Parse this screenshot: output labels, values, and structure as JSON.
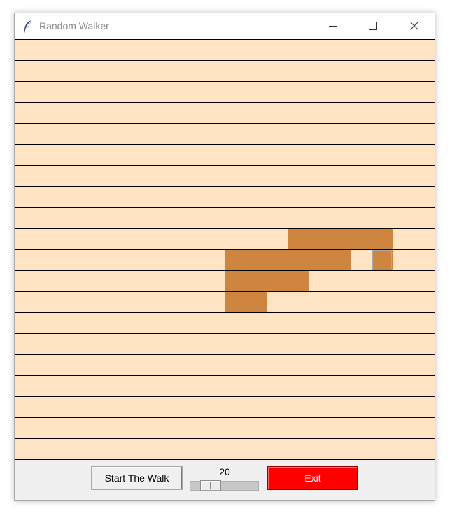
{
  "window": {
    "title": "Random Walker",
    "icon": "feather-icon",
    "controls": [
      "minimize-icon",
      "maximize-icon",
      "close-icon"
    ]
  },
  "grid": {
    "rows": 20,
    "columns": 20,
    "empty_color": "#FFE4C4",
    "walked_color": "#CD853F",
    "line_color": "#000000",
    "walked_cells": [
      [
        9,
        13
      ],
      [
        9,
        14
      ],
      [
        9,
        15
      ],
      [
        9,
        16
      ],
      [
        9,
        17
      ],
      [
        10,
        10
      ],
      [
        10,
        11
      ],
      [
        10,
        12
      ],
      [
        10,
        13
      ],
      [
        10,
        14
      ],
      [
        10,
        15
      ],
      [
        10,
        17
      ],
      [
        11,
        10
      ],
      [
        11,
        11
      ],
      [
        11,
        12
      ],
      [
        11,
        13
      ],
      [
        12,
        10
      ],
      [
        12,
        11
      ]
    ],
    "current_cell": [
      10,
      17
    ],
    "current_outline_color": "#A9A9A9"
  },
  "controls": {
    "start_label": "Start The Walk",
    "speed_value": "20",
    "speed_fraction": 0.2,
    "exit_label": "Exit",
    "exit_color": "#FF0000"
  }
}
